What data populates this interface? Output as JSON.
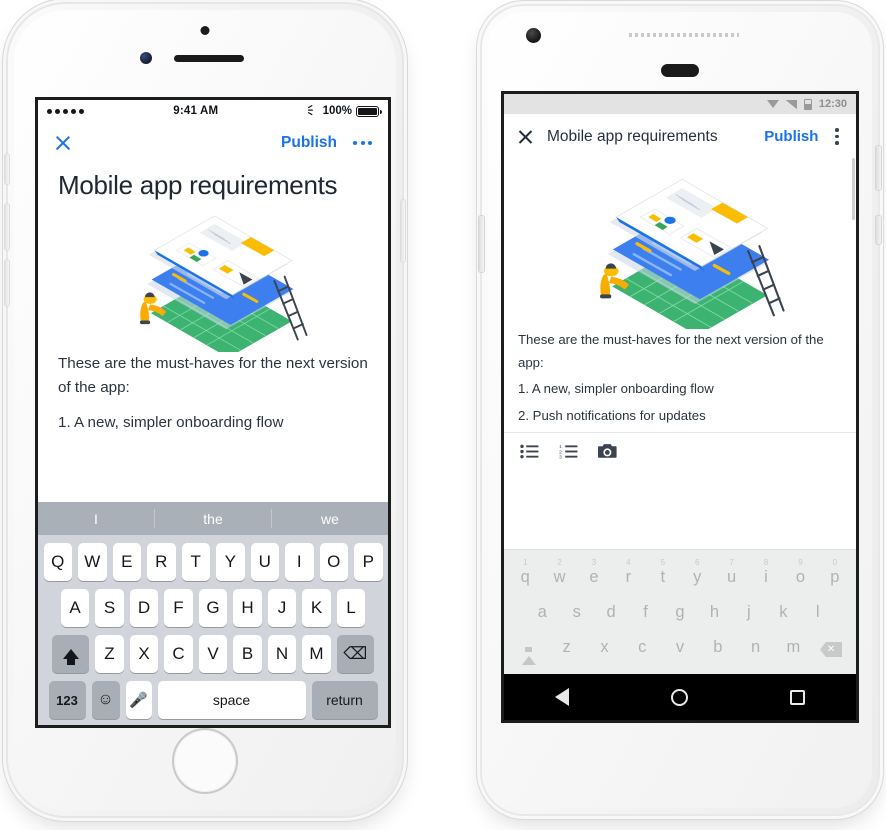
{
  "ios": {
    "status_bar": {
      "signal_dots": 5,
      "time": "9:41 AM",
      "bluetooth_icon": "bluetooth-icon",
      "battery_percent": "100%"
    },
    "app_bar": {
      "close_icon": "close-icon",
      "publish_label": "Publish",
      "overflow_icon": "more-horizontal-icon"
    },
    "document": {
      "title": "Mobile app requirements",
      "illustration": "layered-design-stack-illustration",
      "paragraph": "These are the must-haves for the next version of the app:",
      "list_items": [
        "1. A new, simpler onboarding flow"
      ]
    },
    "keyboard": {
      "predictions": [
        "I",
        "the",
        "we"
      ],
      "row1": [
        "Q",
        "W",
        "E",
        "R",
        "T",
        "Y",
        "U",
        "I",
        "O",
        "P"
      ],
      "row2": [
        "A",
        "S",
        "D",
        "F",
        "G",
        "H",
        "J",
        "K",
        "L"
      ],
      "row3": [
        "Z",
        "X",
        "C",
        "V",
        "B",
        "N",
        "M"
      ],
      "shift_icon": "shift-arrow-icon",
      "backspace_icon": "backspace-icon",
      "numbers_label": "123",
      "emoji_icon": "emoji-smiley-icon",
      "mic_icon": "microphone-icon",
      "space_label": "space",
      "return_label": "return"
    }
  },
  "android": {
    "status_bar": {
      "dropdown_icon": "caret-down-icon",
      "signal_icon": "signal-bars-icon",
      "battery_icon": "battery-icon",
      "time": "12:30"
    },
    "app_bar": {
      "close_icon": "close-icon",
      "title": "Mobile app requirements",
      "publish_label": "Publish",
      "overflow_icon": "more-vertical-icon"
    },
    "document": {
      "illustration": "layered-design-stack-illustration",
      "paragraph": "These are the must-haves for the next version of the app:",
      "list_items": [
        "1. A new, simpler onboarding flow",
        "2. Push notifications for updates"
      ]
    },
    "format_toolbar": {
      "bulleted_list_icon": "bulleted-list-icon",
      "numbered_list_icon": "numbered-list-icon",
      "camera_icon": "camera-icon"
    },
    "keyboard": {
      "number_hints": [
        "1",
        "2",
        "3",
        "4",
        "5",
        "6",
        "7",
        "8",
        "9",
        "0"
      ],
      "row1": [
        "q",
        "w",
        "e",
        "r",
        "t",
        "y",
        "u",
        "i",
        "o",
        "p"
      ],
      "row2": [
        "a",
        "s",
        "d",
        "f",
        "g",
        "h",
        "j",
        "k",
        "l"
      ],
      "row3": [
        "z",
        "x",
        "c",
        "v",
        "b",
        "n",
        "m"
      ],
      "shift_icon": "shift-arrow-icon",
      "backspace_icon": "backspace-icon"
    },
    "nav_bar": {
      "back_icon": "back-triangle-icon",
      "home_icon": "home-circle-icon",
      "recents_icon": "recents-square-icon"
    }
  },
  "colors": {
    "accent_blue": "#1a73e8",
    "text_dark": "#2b343f",
    "illustration_blue": "#1e6ef0",
    "illustration_green": "#34a853",
    "illustration_yellow": "#fbbc04"
  }
}
